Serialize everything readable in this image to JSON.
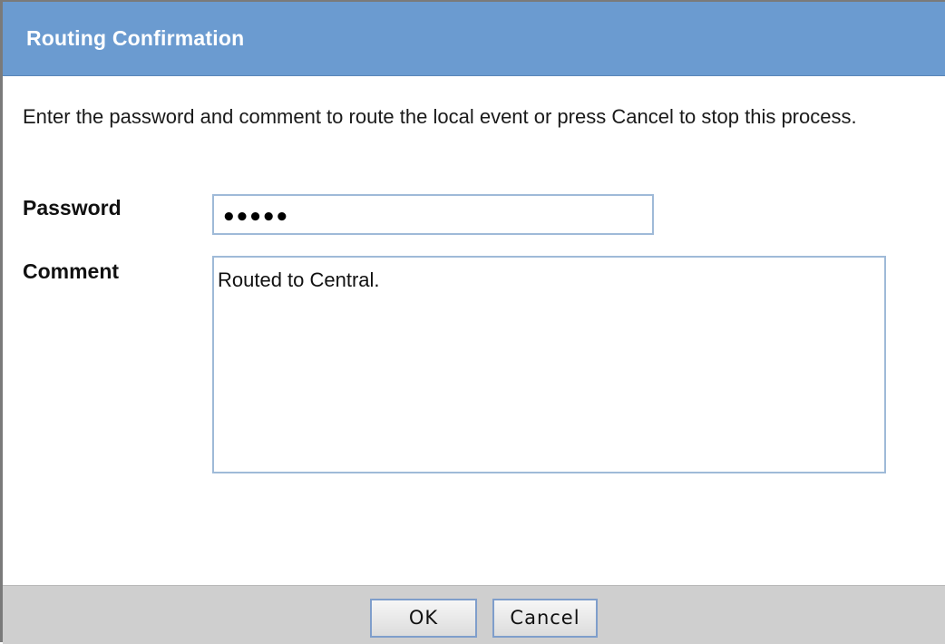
{
  "dialog": {
    "title": "Routing Confirmation",
    "instructions": "Enter the password and comment to route the local event or press Cancel to stop this process."
  },
  "form": {
    "password_label": "Password",
    "password_value": "•••••",
    "comment_label": "Comment",
    "comment_value": "Routed to Central."
  },
  "buttons": {
    "ok_label": "OK",
    "cancel_label": "Cancel"
  },
  "colors": {
    "titlebar": "#6b9bd0",
    "field_border": "#9fbad8",
    "footer": "#cfcfcf"
  }
}
